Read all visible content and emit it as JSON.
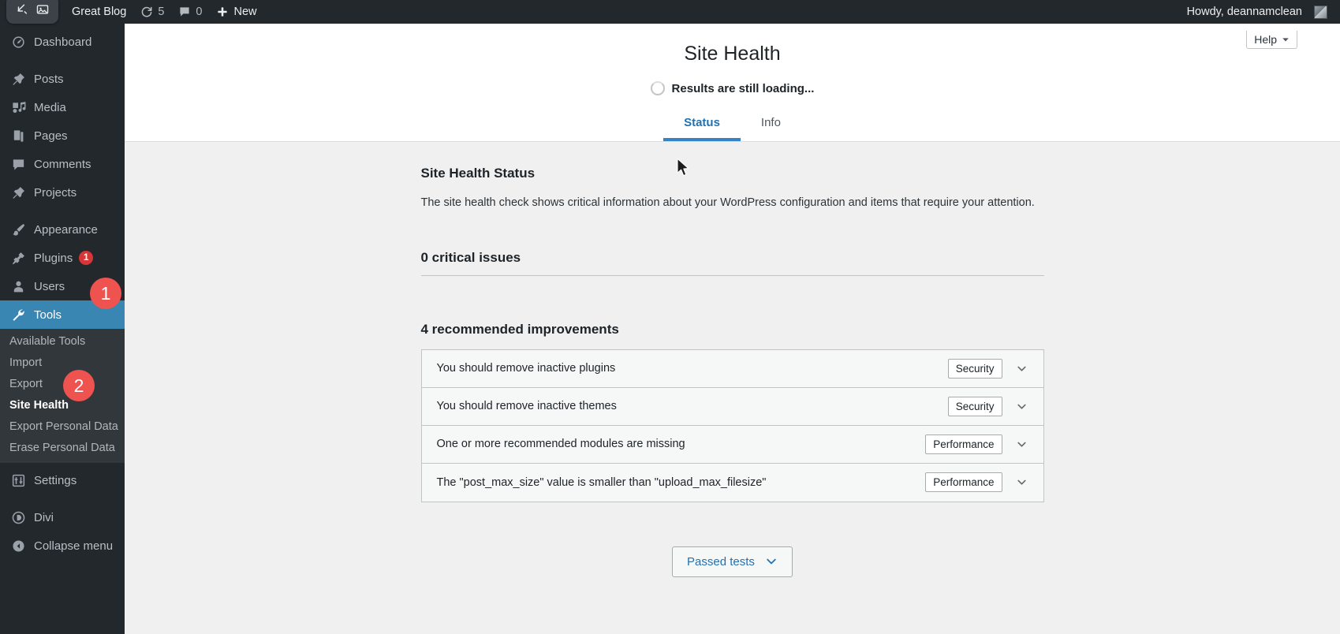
{
  "adminbar": {
    "site_name": "Great Blog",
    "updates_icon": "update-icon",
    "updates_count": "5",
    "comments_icon": "comment-bubble-icon",
    "comments_count": "0",
    "new_icon": "plus-icon",
    "new_label": "New",
    "howdy": "Howdy, deannamclean",
    "avatar_icon": "avatar-image",
    "capture_icons": [
      "arrow-diagonal-icon",
      "screenshot-icon"
    ]
  },
  "sidebar": {
    "items": [
      {
        "label": "Dashboard",
        "icon": "dashboard-icon",
        "current": false,
        "badge": ""
      },
      {
        "label": "Posts",
        "icon": "pin-icon",
        "current": false,
        "badge": ""
      },
      {
        "label": "Media",
        "icon": "media-icon",
        "current": false,
        "badge": ""
      },
      {
        "label": "Pages",
        "icon": "pages-icon",
        "current": false,
        "badge": ""
      },
      {
        "label": "Comments",
        "icon": "comment-bubble-icon",
        "current": false,
        "badge": ""
      },
      {
        "label": "Projects",
        "icon": "pin-icon",
        "current": false,
        "badge": ""
      },
      {
        "label": "Appearance",
        "icon": "paintbrush-icon",
        "current": false,
        "badge": ""
      },
      {
        "label": "Plugins",
        "icon": "plug-icon",
        "current": false,
        "badge": "1"
      },
      {
        "label": "Users",
        "icon": "user-icon",
        "current": false,
        "badge": ""
      },
      {
        "label": "Tools",
        "icon": "wrench-icon",
        "current": true,
        "badge": ""
      }
    ],
    "submenu": [
      {
        "label": "Available Tools",
        "current": false
      },
      {
        "label": "Import",
        "current": false
      },
      {
        "label": "Export",
        "current": false
      },
      {
        "label": "Site Health",
        "current": true
      },
      {
        "label": "Export Personal Data",
        "current": false
      },
      {
        "label": "Erase Personal Data",
        "current": false
      }
    ],
    "items_after": [
      {
        "label": "Settings",
        "icon": "settings-sliders-icon",
        "current": false,
        "badge": ""
      },
      {
        "label": "Divi",
        "icon": "divi-icon",
        "current": false,
        "badge": ""
      },
      {
        "label": "Collapse menu",
        "icon": "collapse-arrow-icon",
        "current": false,
        "badge": ""
      }
    ],
    "step_markers": [
      {
        "number": "1",
        "target": "tools-menu-item"
      },
      {
        "number": "2",
        "target": "site-health-submenu-item"
      }
    ]
  },
  "header": {
    "help_label": "Help",
    "help_icon": "chevron-down-icon",
    "title": "Site Health",
    "loading_text": "Results are still loading...",
    "spinner_icon": "loading-spinner-icon",
    "tabs": [
      {
        "label": "Status",
        "active": true
      },
      {
        "label": "Info",
        "active": false
      }
    ]
  },
  "main": {
    "section_title": "Site Health Status",
    "section_description": "The site health check shows critical information about your WordPress configuration and items that require your attention.",
    "critical_heading": "0 critical issues",
    "recommended_heading": "4 recommended improvements",
    "issues": [
      {
        "title": "You should remove inactive plugins",
        "badge": "Security",
        "chevron": "chevron-down-icon"
      },
      {
        "title": "You should remove inactive themes",
        "badge": "Security",
        "chevron": "chevron-down-icon"
      },
      {
        "title": "One or more recommended modules are missing",
        "badge": "Performance",
        "chevron": "chevron-down-icon"
      },
      {
        "title": "The \"post_max_size\" value is smaller than \"upload_max_filesize\"",
        "badge": "Performance",
        "chevron": "chevron-down-icon"
      }
    ],
    "passed_tests_label": "Passed tests",
    "passed_tests_icon": "chevron-down-icon"
  },
  "colors": {
    "admin_dark": "#23282d",
    "submenu_dark": "#32373c",
    "accent_blue": "#3986b3",
    "link_blue": "#2271b1",
    "badge_red": "#d63638",
    "marker_red": "#ef5350",
    "body_gray": "#f0f0f1"
  }
}
